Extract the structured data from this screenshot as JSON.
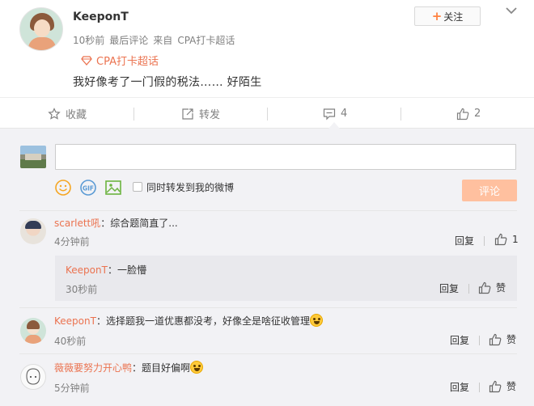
{
  "post": {
    "username": "KeeponT",
    "follow_label": "关注",
    "time": "10秒前",
    "comment_label": "最后评论",
    "source_prefix": "来自",
    "source": "CPA打卡超话",
    "topic": "CPA打卡超话",
    "text": "我好像考了一门假的税法…… 好陌生"
  },
  "actions": {
    "favorite": "收藏",
    "repost": "转发",
    "comment_count": "4",
    "like_count": "2"
  },
  "composer": {
    "input_value": "",
    "also_repost_label": "同时转发到我的微博",
    "submit_label": "评论"
  },
  "comments": [
    {
      "name": "scarlett吼",
      "text": "：综合题简直了...",
      "time": "4分钟前",
      "reply_label": "回复",
      "like_label": "1",
      "reply": {
        "name": "KeeponT",
        "text": "：一脸懵",
        "time": "30秒前",
        "reply_label": "回复",
        "like_label": "赞"
      }
    },
    {
      "name": "KeeponT",
      "text": "：选择题我一道优惠都没考，好像全是啥征收管理",
      "time": "40秒前",
      "reply_label": "回复",
      "like_label": "赞"
    },
    {
      "name": "薇薇要努力开心鸭",
      "text": "：题目好偏啊",
      "time": "5分钟前",
      "reply_label": "回复",
      "like_label": "赞"
    }
  ],
  "colors": {
    "accent": "#eb7350",
    "submit_disabled": "#ffc09f",
    "comment_bg": "#f2f2f5"
  }
}
